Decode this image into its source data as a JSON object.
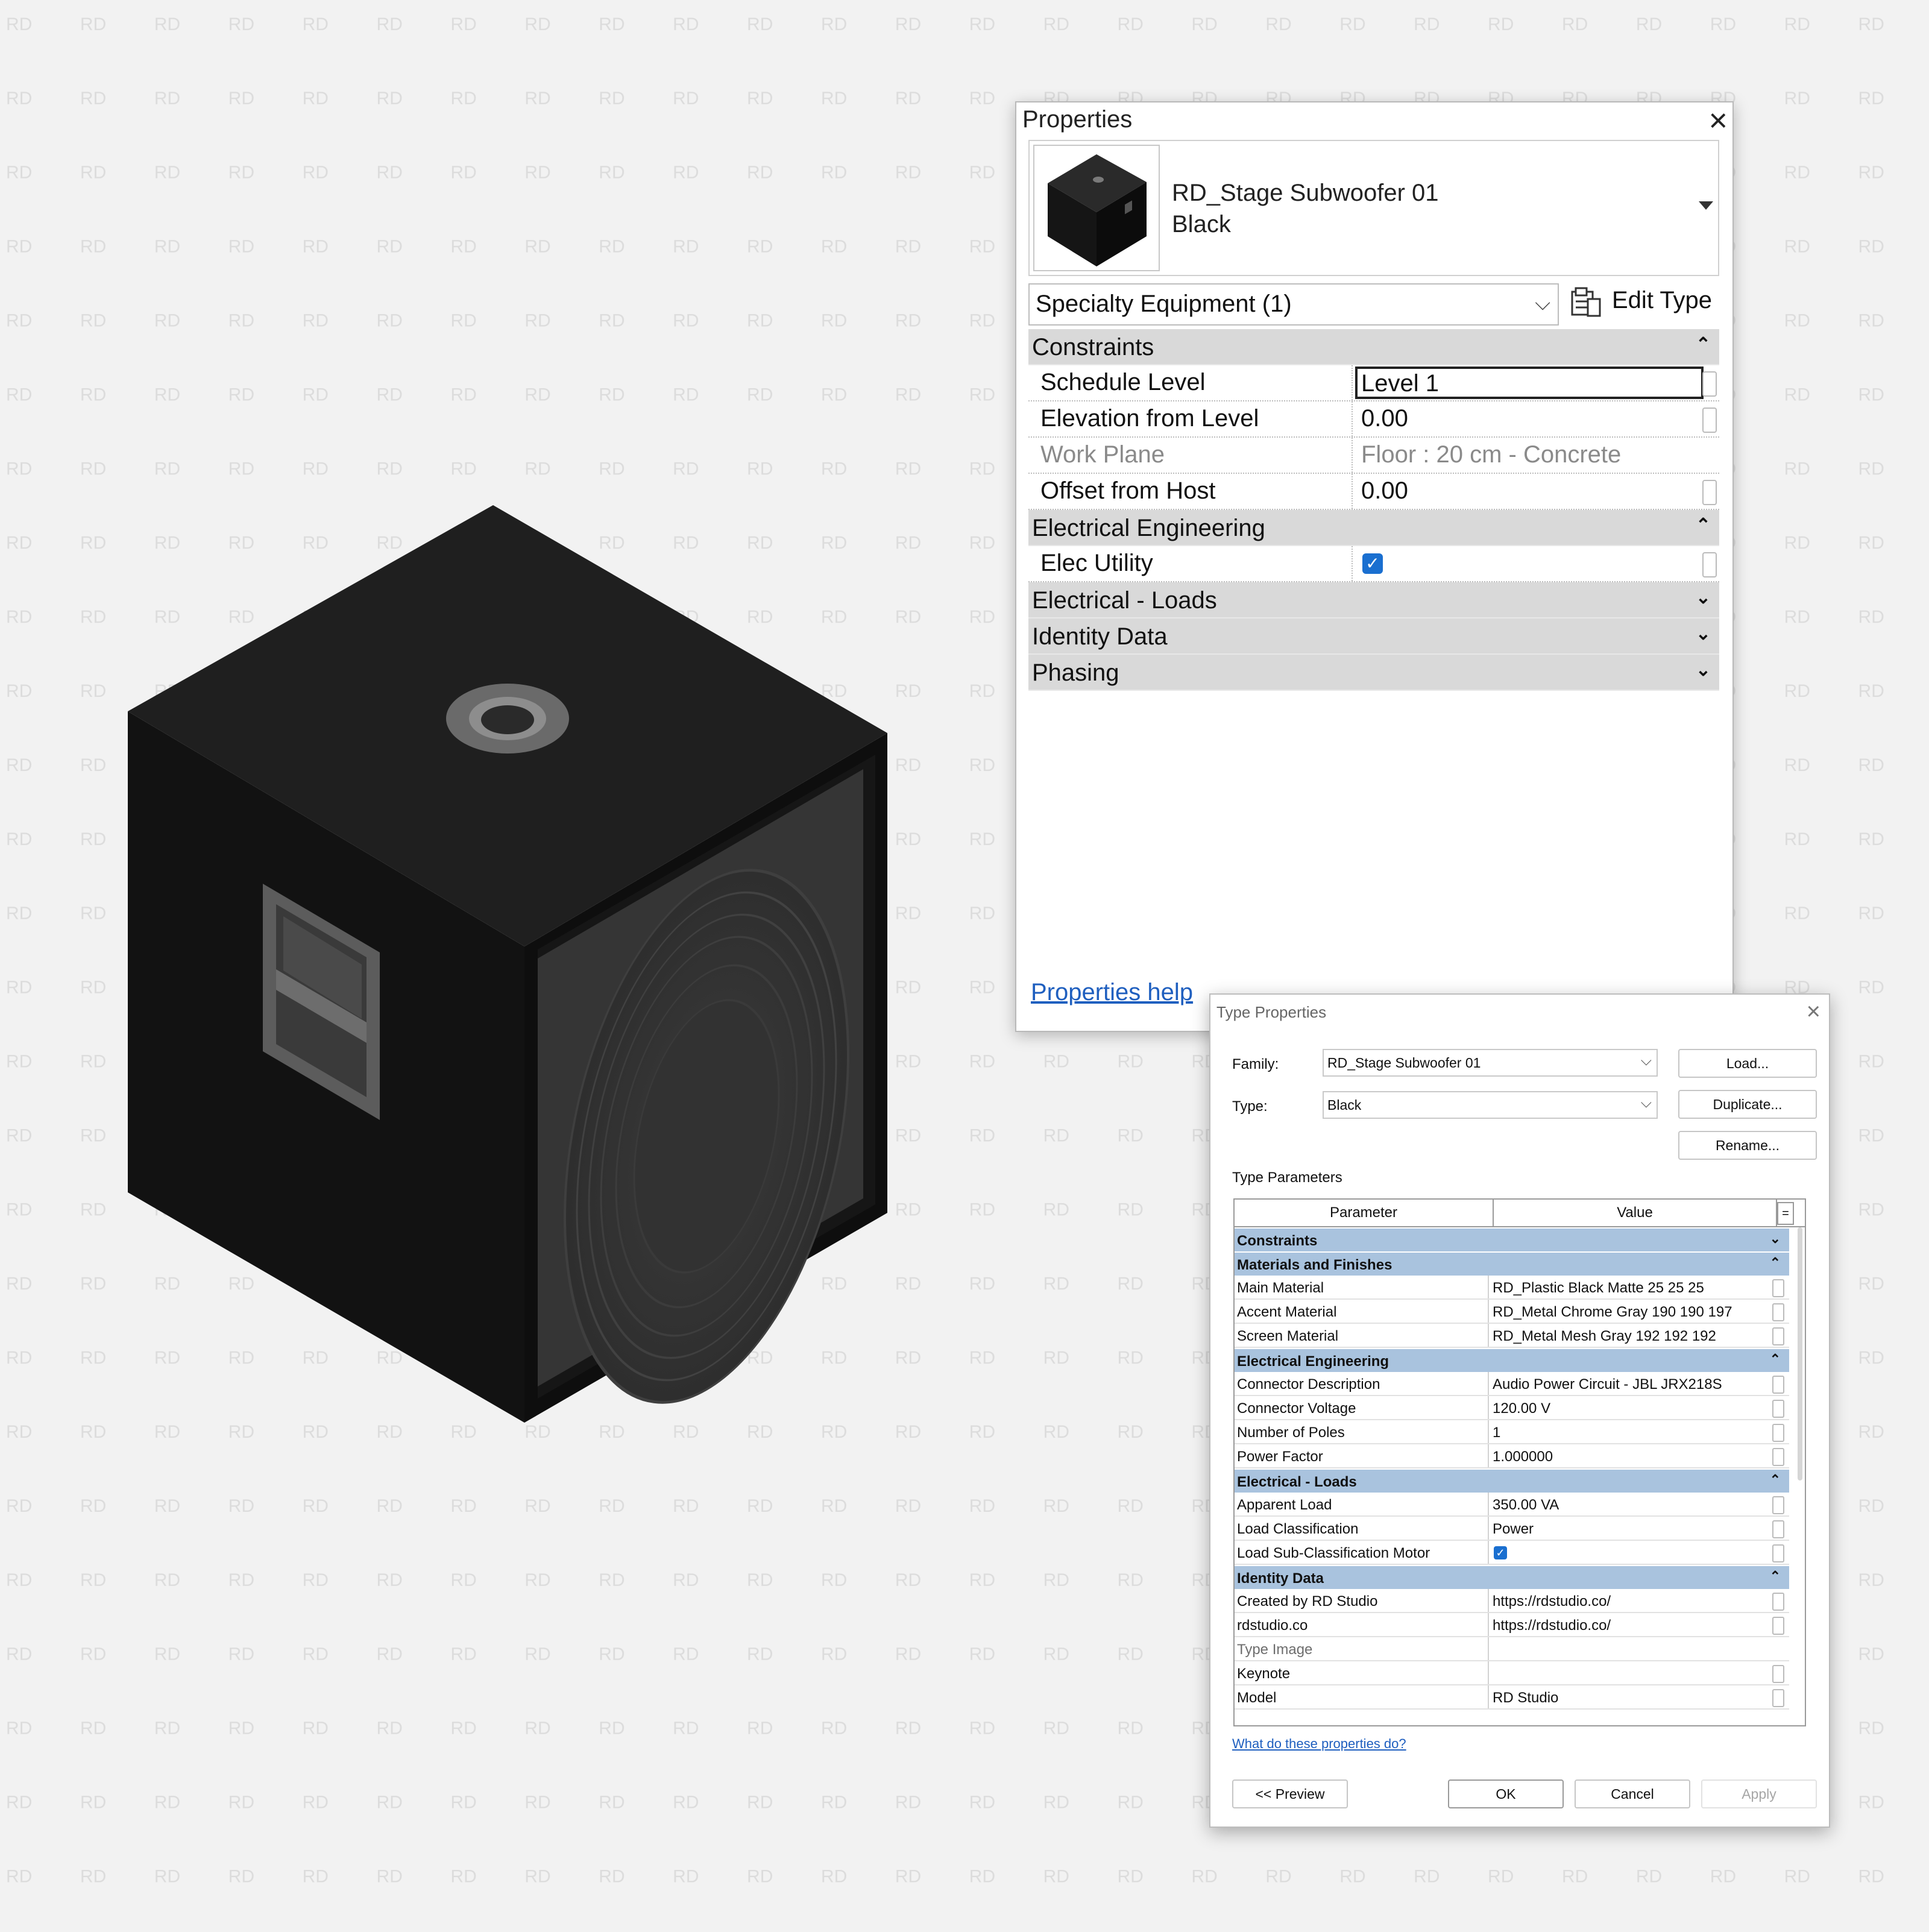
{
  "watermark": {
    "text": "RD"
  },
  "properties": {
    "title": "Properties",
    "type_selector": {
      "family": "RD_Stage Subwoofer 01",
      "type": "Black"
    },
    "category_filter": "Specialty Equipment (1)",
    "edit_type_label": "Edit Type",
    "groups": {
      "constraints": {
        "name": "Constraints",
        "rows": [
          {
            "name": "Schedule Level",
            "value": "Level 1"
          },
          {
            "name": "Elevation from Level",
            "value": "0.00"
          },
          {
            "name": "Work Plane",
            "value": "Floor : 20 cm - Concrete"
          },
          {
            "name": "Offset from Host",
            "value": "0.00"
          }
        ]
      },
      "electrical_engineering": {
        "name": "Electrical Engineering",
        "rows": [
          {
            "name": "Elec Utility",
            "checked": true
          }
        ]
      },
      "electrical_loads": {
        "name": "Electrical - Loads"
      },
      "identity_data": {
        "name": "Identity Data"
      },
      "phasing": {
        "name": "Phasing"
      }
    },
    "help_link": "Properties help"
  },
  "type_properties": {
    "title": "Type Properties",
    "family_label": "Family:",
    "family_value": "RD_Stage Subwoofer 01",
    "type_label": "Type:",
    "type_value": "Black",
    "buttons": {
      "load": "Load...",
      "duplicate": "Duplicate...",
      "rename": "Rename...",
      "preview": "<< Preview",
      "ok": "OK",
      "cancel": "Cancel",
      "apply": "Apply"
    },
    "section_label": "Type Parameters",
    "columns": {
      "parameter": "Parameter",
      "value": "Value",
      "eq": "="
    },
    "groups": {
      "constraints": {
        "name": "Constraints"
      },
      "materials": {
        "name": "Materials and Finishes",
        "rows": [
          {
            "name": "Main Material",
            "value": "RD_Plastic Black Matte 25 25 25"
          },
          {
            "name": "Accent Material",
            "value": "RD_Metal Chrome Gray 190 190 197"
          },
          {
            "name": "Screen Material",
            "value": "RD_Metal Mesh Gray 192 192 192"
          }
        ]
      },
      "electrical_engineering": {
        "name": "Electrical Engineering",
        "rows": [
          {
            "name": "Connector Description",
            "value": "Audio Power Circuit - JBL JRX218S"
          },
          {
            "name": "Connector Voltage",
            "value": "120.00 V"
          },
          {
            "name": "Number of Poles",
            "value": "1"
          },
          {
            "name": "Power Factor",
            "value": "1.000000"
          }
        ]
      },
      "electrical_loads": {
        "name": "Electrical - Loads",
        "rows": [
          {
            "name": "Apparent Load",
            "value": "350.00 VA"
          },
          {
            "name": "Load Classification",
            "value": "Power"
          },
          {
            "name": "Load Sub-Classification Motor",
            "checked": true
          }
        ]
      },
      "identity_data": {
        "name": "Identity Data",
        "rows": [
          {
            "name": "Created by RD Studio",
            "value": "https://rdstudio.co/"
          },
          {
            "name": "rdstudio.co",
            "value": "https://rdstudio.co/"
          },
          {
            "name": "Type Image",
            "value": ""
          },
          {
            "name": "Keynote",
            "value": ""
          },
          {
            "name": "Model",
            "value": "RD Studio"
          }
        ]
      }
    },
    "help_link": "What do these properties do?"
  },
  "colors": {
    "group_blue": "#a9c3de",
    "checkbox_blue": "#1a6fd0",
    "link_blue": "#1f5fbf"
  }
}
